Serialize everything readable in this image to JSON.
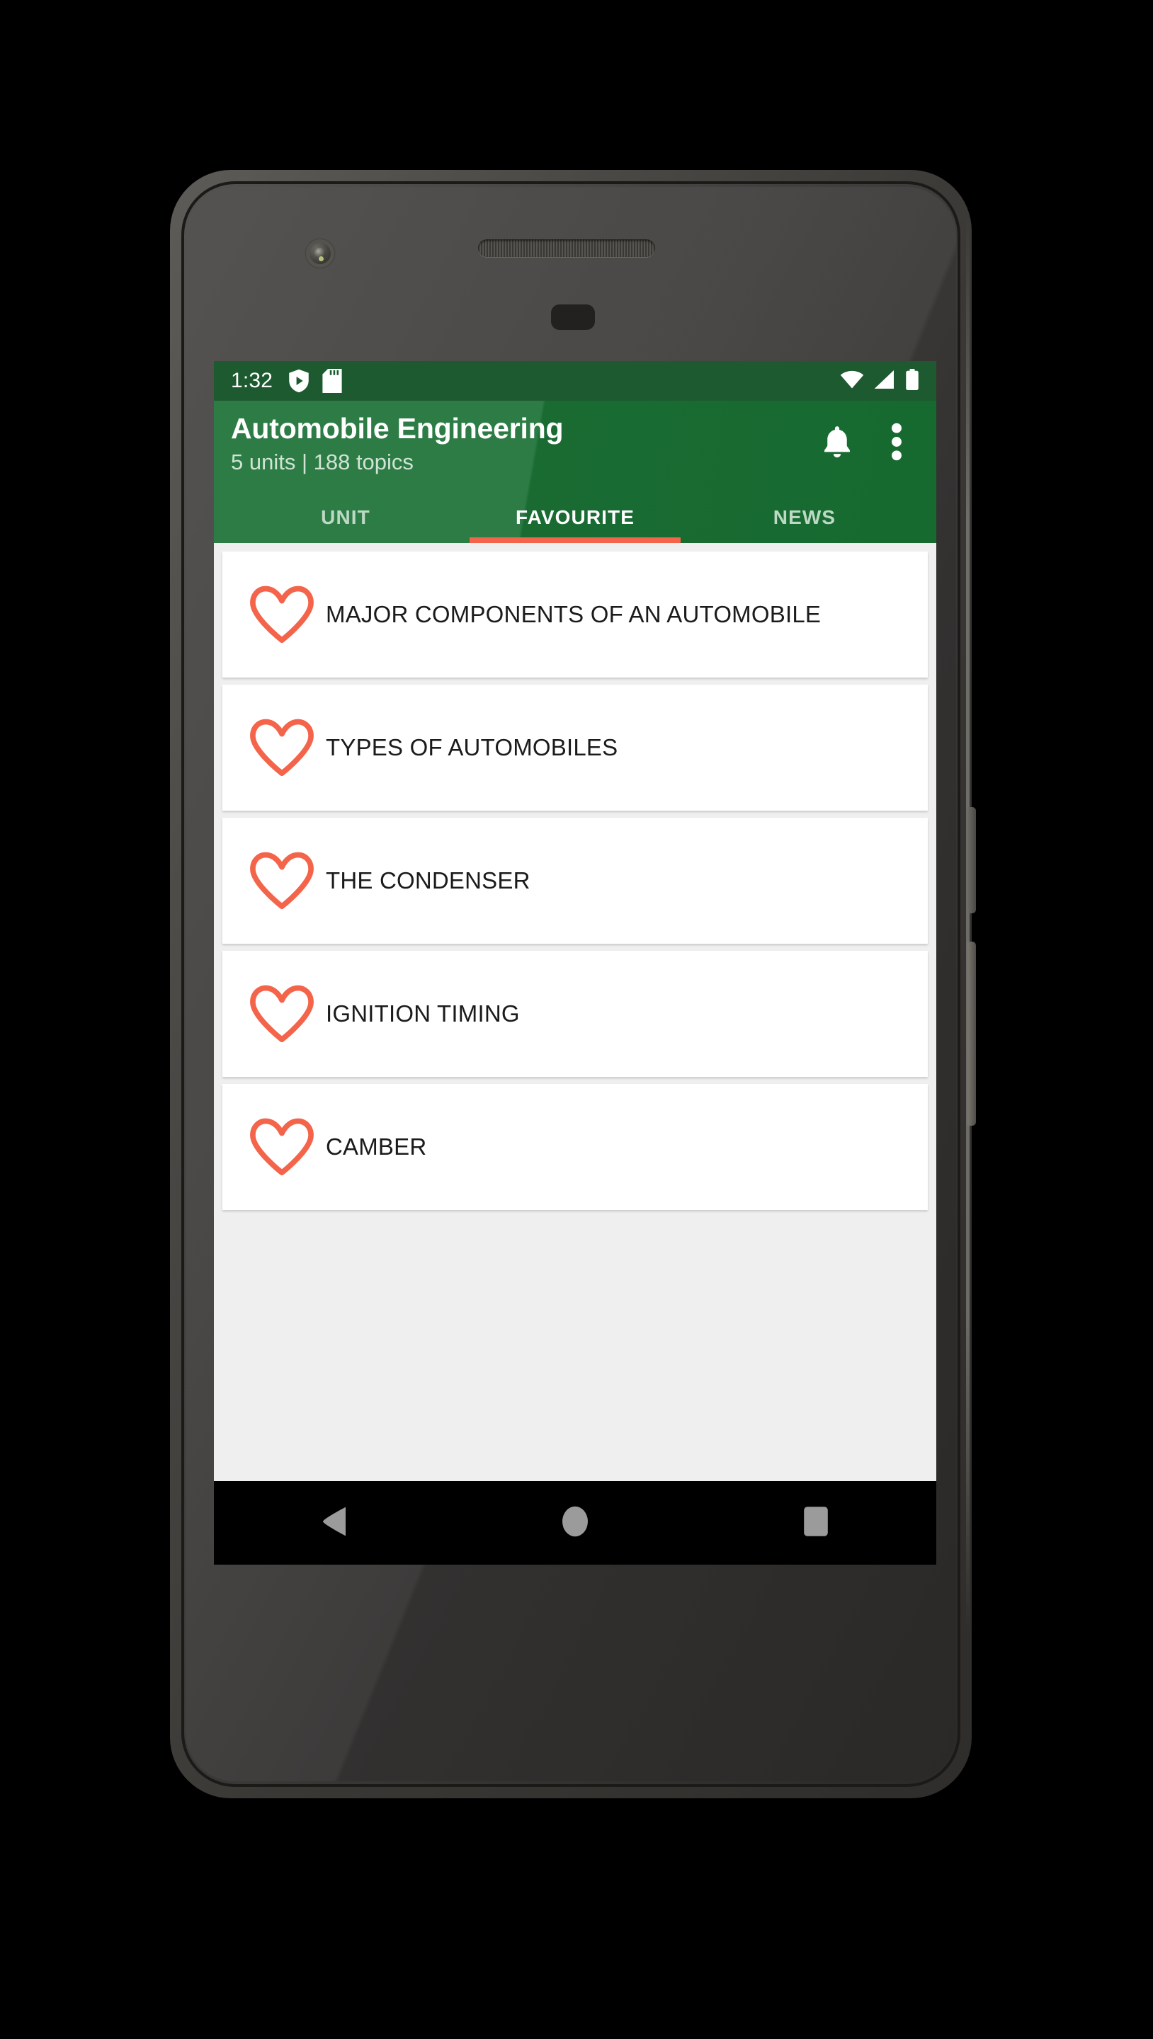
{
  "device": {
    "name": "android-phone-mockup",
    "hardware": {
      "front_camera": "camera-icon",
      "earpiece": "speaker-grille",
      "proximity_sensor": "sensor",
      "power_button": "power-button",
      "volume_button": "volume-button"
    }
  },
  "status_bar": {
    "time": "1:32",
    "left_icons": [
      "shield-play-icon",
      "sd-card-icon"
    ],
    "right_icons": [
      "wifi-icon",
      "cellular-signal-icon",
      "battery-icon"
    ],
    "background_color": "#1d5a30",
    "text_color": "#ffffff"
  },
  "app_bar": {
    "title": "Automobile Engineering",
    "subtitle": "5 units | 188 topics",
    "background_color": "#2d7c46",
    "actions": [
      {
        "name": "notifications",
        "icon": "bell-icon"
      },
      {
        "name": "overflow-menu",
        "icon": "more-vert-icon"
      }
    ]
  },
  "tabs": {
    "active_index": 1,
    "indicator_color": "#f4644a",
    "items": [
      {
        "label": "UNIT"
      },
      {
        "label": "FAVOURITE"
      },
      {
        "label": "NEWS"
      }
    ]
  },
  "favourites": {
    "heart_color": "#f4644a",
    "items": [
      {
        "label": "MAJOR COMPONENTS OF AN AUTOMOBILE",
        "icon": "heart-outline-icon"
      },
      {
        "label": "TYPES OF AUTOMOBILES",
        "icon": "heart-outline-icon"
      },
      {
        "label": "THE CONDENSER",
        "icon": "heart-outline-icon"
      },
      {
        "label": "IGNITION TIMING",
        "icon": "heart-outline-icon"
      },
      {
        "label": "CAMBER",
        "icon": "heart-outline-icon"
      }
    ]
  },
  "navigation_bar": {
    "background_color": "#000000",
    "buttons": [
      {
        "name": "back",
        "icon": "back-triangle-icon"
      },
      {
        "name": "home",
        "icon": "home-circle-icon"
      },
      {
        "name": "recents",
        "icon": "recents-square-icon"
      }
    ]
  }
}
